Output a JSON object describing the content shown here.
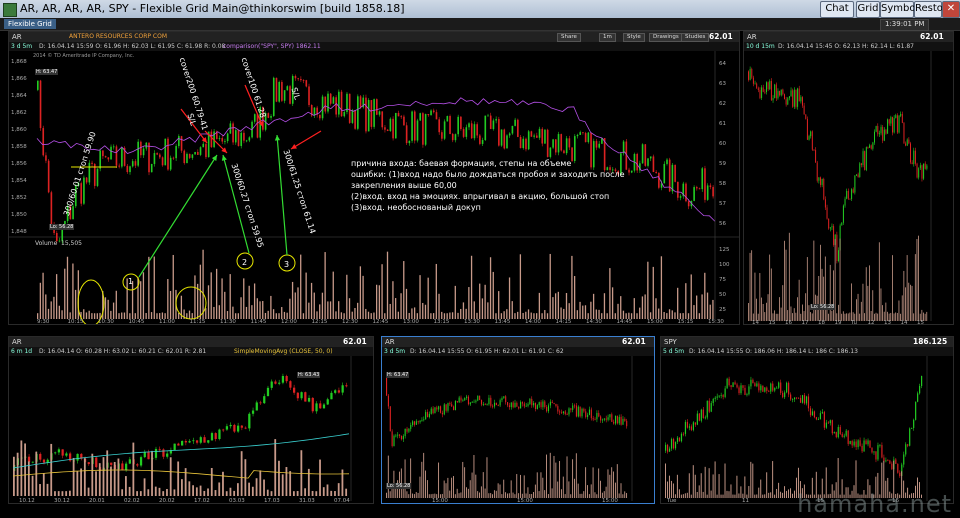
{
  "window": {
    "title": "AR, AR, AR, AR, SPY - Flexible Grid Main@thinkorswim [build 1858.18]",
    "buttons": [
      "Chat",
      "Grid",
      "Symbols",
      "Restore"
    ],
    "time": "1:39:01 PM"
  },
  "toolbar": {
    "tab": "Flexible Grid"
  },
  "main": {
    "symbol": "AR",
    "price": "62.01",
    "period": "3 d 5m",
    "info": "D: 16.04.14 15:59   O: 61.96   H: 62.03   L: 61.95   C: 61.98   R: 0.08",
    "company": "ANTERO RESOURCES CORP COM",
    "study": "comparison(\"SPY\", SPY)  1862.11",
    "copyright": "2014 © TD Ameritrade IP Company, Inc.",
    "hi_label": "H: 63.47",
    "lo_label": "Lo: 56.28",
    "volume_label": "Volume",
    "volume_value": "15,505",
    "time_ticks": [
      "9:30",
      "10:15",
      "10:30",
      "10:45",
      "11:00",
      "11:15",
      "11:30",
      "11:45",
      "12:00",
      "12:15",
      "12:30",
      "12:45",
      "13:00",
      "13:15",
      "13:30",
      "13:45",
      "14:00",
      "14:15",
      "14:30",
      "14:45",
      "15:00",
      "15:15",
      "15:30"
    ],
    "y_left": [
      "1,868",
      "1,866",
      "1,864",
      "1,862",
      "1,860",
      "1,858",
      "1,856",
      "1,854",
      "1,852",
      "1,850",
      "1,848"
    ],
    "y_right": [
      "64",
      "63",
      "62",
      "61",
      "60",
      "59",
      "58",
      "57",
      "56"
    ],
    "vol_right": [
      "125",
      "100",
      "75",
      "50",
      "25"
    ],
    "buttons": {
      "share": "Share",
      "style": "Style",
      "drawings": "Drawings",
      "studies": "Studies"
    }
  },
  "annotations": {
    "a1": "300/60.01 стоп 59.90",
    "a2": "cover200 60.79-41",
    "a3": "S/L",
    "a4": "300/60.27 стоп 59.95",
    "a5": "cover100 61.28",
    "a6": "S/L",
    "a7": "300/61.25 стоп 61.14",
    "n1": "1",
    "n2": "2",
    "n3": "3",
    "note_lines": [
      "причина входа: баевая формация, степы на объеме",
      "ошибки: (1)вход надо было дождаться пробоя и заходить после",
      "закрепления выше 60,00",
      "(2)вход. вход на эмоциях. впрыгивал в акцию, большой стоп",
      "(3)вход. необоснованый докуп"
    ]
  },
  "right_panel": {
    "symbol": "AR",
    "period": "10 d 15m",
    "price": "62.01",
    "info": "D: 16.04.14 15:45  O: 62.13  H: 62.14  L: 61.87",
    "x_ticks": [
      "14",
      "15",
      "16",
      "17",
      "18",
      "19",
      "Tu",
      "12",
      "13",
      "14",
      "15"
    ],
    "lo_label": "Lo: 56.28"
  },
  "bottom": [
    {
      "symbol": "AR",
      "period": "6 m 1d",
      "price": "62.01",
      "info": "D: 16.04.14  O: 60.28  H: 63.02  L: 60.21  C: 62.01  R: 2.81",
      "study": "SimpleMovingAvg (CLOSE, 50, 0)",
      "x_ticks": [
        "10.12",
        "30.12",
        "20.01",
        "02.02",
        "20.02",
        "17.02",
        "03.03",
        "17.03",
        "31.03",
        "07.04"
      ],
      "hi_label": "H: 63.43"
    },
    {
      "symbol": "AR",
      "period": "3 d 5m",
      "price": "62.01",
      "info": "D: 16.04.14 15:55  O: 61.95  H: 62.01  L: 61.91  C: 62",
      "hi_label": "H: 63.47",
      "lo_label": "Lo: 56.28",
      "x_ticks": [
        "15:00",
        "15:00",
        "15:00"
      ]
    },
    {
      "symbol": "SPY",
      "period": "5 d 5m",
      "price": "186.125",
      "info": "D: 16.04.14 15:55  O: 186.06  H: 186.14  L: 186  C: 186.13",
      "x_ticks": [
        "Tue",
        "11",
        "15",
        "16"
      ]
    }
  ],
  "watermark": "hamaha.net",
  "colors": {
    "up": "#22cc22",
    "down": "#dd2222",
    "compare": "#b44fe6",
    "volume": "#c89a8a",
    "arrow_red": "#ff2020",
    "arrow_green": "#33dd33",
    "circle": "#e6e600"
  }
}
